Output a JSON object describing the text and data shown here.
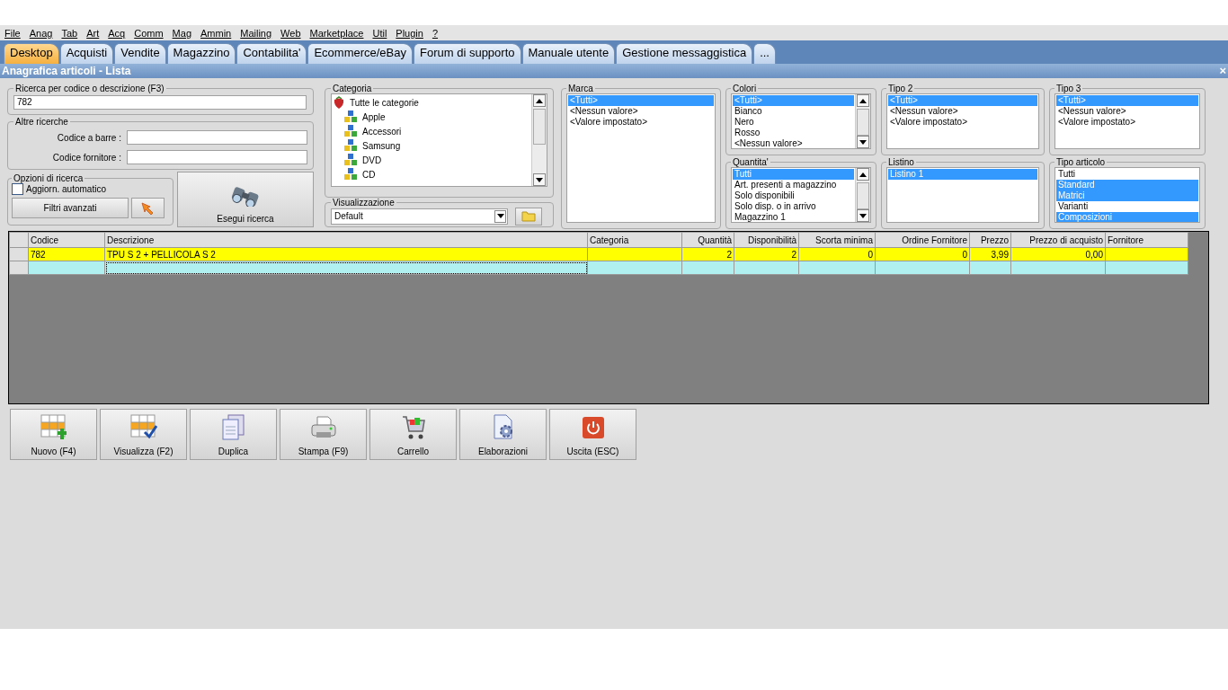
{
  "menu": [
    "File",
    "Anag",
    "Tab",
    "Art",
    "Acq",
    "Comm",
    "Mag",
    "Ammin",
    "Mailing",
    "Web",
    "Marketplace",
    "Util",
    "Plugin",
    "?"
  ],
  "tabs": [
    {
      "label": "Desktop",
      "selected": true
    },
    {
      "label": "Acquisti",
      "selected": false
    },
    {
      "label": "Vendite",
      "selected": false
    },
    {
      "label": "Magazzino",
      "selected": false
    },
    {
      "label": "Contabilita'",
      "selected": false
    },
    {
      "label": "Ecommerce/eBay",
      "selected": false
    },
    {
      "label": "Forum di supporto",
      "selected": false
    },
    {
      "label": "Manuale utente",
      "selected": false
    },
    {
      "label": "Gestione messaggistica",
      "selected": false
    },
    {
      "label": "...",
      "selected": false
    }
  ],
  "panel": {
    "title": "Anagrafica articoli  - Lista",
    "close": "×"
  },
  "search": {
    "title": "Ricerca per codice o descrizione (F3)",
    "value": "782"
  },
  "other_searches": {
    "title": "Altre ricerche",
    "fields": [
      {
        "label": "Codice a barre :"
      },
      {
        "label": "Codice fornitore :"
      }
    ]
  },
  "options": {
    "title": "Opzioni di ricerca",
    "auto_update": {
      "label": "Aggiorn. automatico",
      "checked": false
    },
    "advanced_filters": "Filtri avanzati"
  },
  "run_search": "Esegui ricerca",
  "category": {
    "title": "Categoria",
    "tree": [
      {
        "label": "Tutte le categorie",
        "children": [
          {
            "label": "Apple"
          },
          {
            "label": "Accessori"
          },
          {
            "label": "Samsung"
          },
          {
            "label": "DVD"
          },
          {
            "label": "CD"
          }
        ]
      }
    ]
  },
  "view": {
    "title": "Visualizzazione",
    "value": "Default"
  },
  "lists": [
    {
      "title": "Marca",
      "scrollable": false,
      "items": [
        {
          "label": "<Tutti>",
          "selected": true
        },
        {
          "label": "<Nessun valore>",
          "selected": false
        },
        {
          "label": "<Valore impostato>",
          "selected": false
        }
      ]
    },
    {
      "title": "Colori",
      "scrollable": true,
      "items": [
        {
          "label": "<Tutti>",
          "selected": true
        },
        {
          "label": "Bianco",
          "selected": false
        },
        {
          "label": "Nero",
          "selected": false
        },
        {
          "label": "Rosso",
          "selected": false
        },
        {
          "label": "<Nessun valore>",
          "selected": false
        }
      ]
    },
    {
      "title": "Quantita'",
      "scrollable": true,
      "items": [
        {
          "label": "Tutti",
          "selected": true
        },
        {
          "label": "Art. presenti a magazzino",
          "selected": false
        },
        {
          "label": "Solo disponibili",
          "selected": false
        },
        {
          "label": "Solo disp. o in arrivo",
          "selected": false
        },
        {
          "label": "Magazzino 1",
          "selected": false
        }
      ]
    },
    {
      "title": "Tipo 2",
      "scrollable": false,
      "items": [
        {
          "label": "<Tutti>",
          "selected": true
        },
        {
          "label": "<Nessun valore>",
          "selected": false
        },
        {
          "label": "<Valore impostato>",
          "selected": false
        }
      ]
    },
    {
      "title": "Listino",
      "scrollable": false,
      "items": [
        {
          "label": "Listino 1",
          "selected": true
        }
      ]
    },
    {
      "title": "Tipo 3",
      "scrollable": false,
      "items": [
        {
          "label": "<Tutti>",
          "selected": true
        },
        {
          "label": "<Nessun valore>",
          "selected": false
        },
        {
          "label": "<Valore impostato>",
          "selected": false
        }
      ]
    },
    {
      "title": "Tipo articolo",
      "scrollable": false,
      "items": [
        {
          "label": "Tutti",
          "selected": false
        },
        {
          "label": "Standard",
          "selected": true
        },
        {
          "label": "Matrici",
          "selected": true
        },
        {
          "label": "Varianti",
          "selected": false
        },
        {
          "label": "Composizioni",
          "selected": true
        }
      ]
    }
  ],
  "table": {
    "columns": [
      {
        "label": "Codice",
        "kind": "text"
      },
      {
        "label": "Descrizione",
        "kind": "text"
      },
      {
        "label": "Categoria",
        "kind": "text"
      },
      {
        "label": "Quantità",
        "kind": "number"
      },
      {
        "label": "Disponibilità",
        "kind": "number"
      },
      {
        "label": "Scorta minima",
        "kind": "number"
      },
      {
        "label": "Ordine Fornitore",
        "kind": "number"
      },
      {
        "label": "Prezzo",
        "kind": "number"
      },
      {
        "label": "Prezzo di acquisto",
        "kind": "number"
      },
      {
        "label": "Fornitore",
        "kind": "text"
      }
    ],
    "rows": [
      {
        "selected": true,
        "cells": [
          "782",
          "TPU S 2 + PELLICOLA S 2",
          null,
          "2",
          "2",
          "0",
          "0",
          "3,99",
          "0,00",
          null
        ]
      },
      {
        "selected": false,
        "cells": [
          null,
          null,
          null,
          null,
          null,
          null,
          null,
          null,
          null,
          null
        ]
      }
    ]
  },
  "actions": [
    "Nuovo (F4)",
    "Visualizza (F2)",
    "Duplica",
    "Stampa (F9)",
    "Carrello",
    "Elaborazioni",
    "Uscita (ESC)"
  ]
}
